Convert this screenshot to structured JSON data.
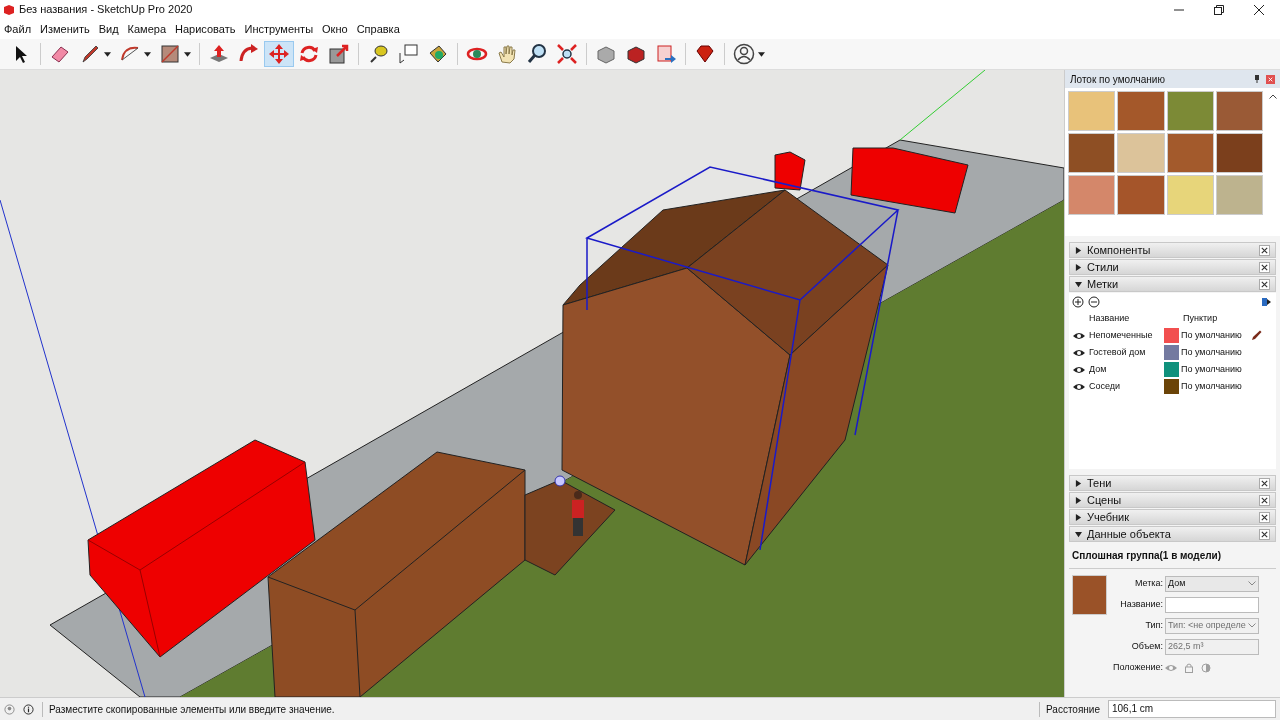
{
  "window": {
    "title": "Без названия - SketchUp Pro 2020"
  },
  "menu": [
    "Файл",
    "Изменить",
    "Вид",
    "Камера",
    "Нарисовать",
    "Инструменты",
    "Окно",
    "Справка"
  ],
  "toolbar": [
    [
      {
        "kind": "select",
        "selected": false,
        "dropdown": false
      }
    ],
    [
      {
        "kind": "eraser",
        "selected": false,
        "dropdown": false
      },
      {
        "kind": "pencil",
        "selected": false,
        "dropdown": true
      },
      {
        "kind": "arc",
        "selected": false,
        "dropdown": true
      },
      {
        "kind": "rectangle",
        "selected": false,
        "dropdown": true
      }
    ],
    [
      {
        "kind": "pushpull",
        "selected": false,
        "dropdown": false
      },
      {
        "kind": "followme",
        "selected": false,
        "dropdown": false
      },
      {
        "kind": "move",
        "selected": true,
        "dropdown": false
      },
      {
        "kind": "rotate",
        "selected": false,
        "dropdown": false
      },
      {
        "kind": "scale",
        "selected": false,
        "dropdown": false
      }
    ],
    [
      {
        "kind": "tape",
        "selected": false,
        "dropdown": false
      },
      {
        "kind": "text",
        "selected": false,
        "dropdown": false
      },
      {
        "kind": "paint",
        "selected": false,
        "dropdown": false
      }
    ],
    [
      {
        "kind": "orbit",
        "selected": false,
        "dropdown": false
      },
      {
        "kind": "pan",
        "selected": false,
        "dropdown": false
      },
      {
        "kind": "zoom",
        "selected": false,
        "dropdown": false
      },
      {
        "kind": "extents",
        "selected": false,
        "dropdown": false
      }
    ],
    [
      {
        "kind": "warehouse",
        "selected": false,
        "dropdown": false
      },
      {
        "kind": "extension",
        "selected": false,
        "dropdown": false
      },
      {
        "kind": "layout",
        "selected": false,
        "dropdown": false
      }
    ],
    [
      {
        "kind": "ruby",
        "selected": false,
        "dropdown": false
      }
    ],
    [
      {
        "kind": "account",
        "selected": false,
        "dropdown": true
      }
    ]
  ],
  "tray": {
    "title": "Лоток по умолчанию",
    "materials": [
      {
        "color": "#e8c27a"
      },
      {
        "color": "#a4582a"
      },
      {
        "color": "#7c8a36"
      },
      {
        "color": "#9a5a36"
      },
      {
        "color": "#8e4f24"
      },
      {
        "color": "#dcc39a"
      },
      {
        "color": "#a35a2c"
      },
      {
        "color": "#7b3f1c"
      },
      {
        "color": "#d4876a"
      },
      {
        "color": "#a5552a"
      },
      {
        "color": "#e7d57a"
      },
      {
        "color": "#bdb38e"
      }
    ],
    "sections_top": [
      {
        "title": "Компоненты",
        "expanded": false
      },
      {
        "title": "Стили",
        "expanded": false
      },
      {
        "title": "Метки",
        "expanded": true
      }
    ],
    "tags": {
      "columns": [
        "Название",
        "Пунктир"
      ],
      "rows": [
        {
          "name": "Непомеченные",
          "color": "#f24f4f",
          "dash": "По умолчанию",
          "visible": true,
          "active": true
        },
        {
          "name": "Гостевой дом",
          "color": "#747aa0",
          "dash": "По умолчанию",
          "visible": true,
          "active": false
        },
        {
          "name": "Дом",
          "color": "#10917c",
          "dash": "По умолчанию",
          "visible": true,
          "active": false
        },
        {
          "name": "Соседи",
          "color": "#6b4408",
          "dash": "По умолчанию",
          "visible": true,
          "active": false
        }
      ]
    },
    "sections_bottom": [
      {
        "title": "Тени",
        "expanded": false
      },
      {
        "title": "Сцены",
        "expanded": false
      },
      {
        "title": "Учебник",
        "expanded": false
      },
      {
        "title": "Данные объекта",
        "expanded": true
      }
    ],
    "entity": {
      "heading": "Сплошная группа(1 в модели)",
      "fields": [
        {
          "kind": "select",
          "label": "Метка:",
          "value": "Дом",
          "disabled": false
        },
        {
          "kind": "input",
          "label": "Название:",
          "disabled": false
        },
        {
          "kind": "select",
          "label": "Тип:",
          "value": "Тип: <не определе",
          "disabled": true
        },
        {
          "kind": "input",
          "label": "Объем:",
          "value": "262,5 m³",
          "disabled": true
        },
        {
          "kind": "toggles",
          "label": "Положение:",
          "disabled": true
        }
      ]
    }
  },
  "status_bar": {
    "message": "Разместите скопированные элементы или введите значение.",
    "measure_label": "Расстояние",
    "measure_value": "106,1 cm"
  }
}
